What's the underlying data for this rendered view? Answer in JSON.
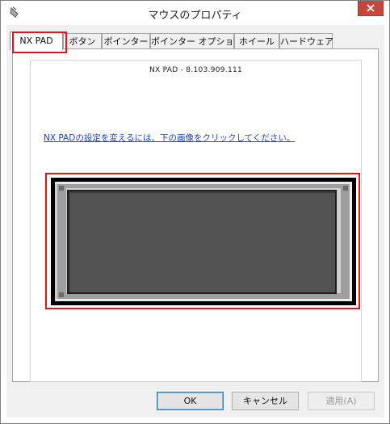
{
  "window": {
    "title": "マウスのプロパティ"
  },
  "tabs": [
    {
      "label": "NX PAD"
    },
    {
      "label": "ボタン"
    },
    {
      "label": "ポインター"
    },
    {
      "label": "ポインター オプション"
    },
    {
      "label": "ホイール"
    },
    {
      "label": "ハードウェア"
    }
  ],
  "active_tab": "NX PAD",
  "group": {
    "title": "NX PAD - 8.103.909.111"
  },
  "link_text": "NX PADの設定を変えるには、下の画像をクリックしてください。",
  "buttons": {
    "ok": "OK",
    "cancel": "キャンセル",
    "apply": "適用(A)"
  },
  "colors": {
    "highlight": "#e3141b",
    "link": "#1a43c8",
    "close": "#c7463b"
  },
  "icons": {
    "app": "mouse-icon",
    "close": "close-icon"
  }
}
